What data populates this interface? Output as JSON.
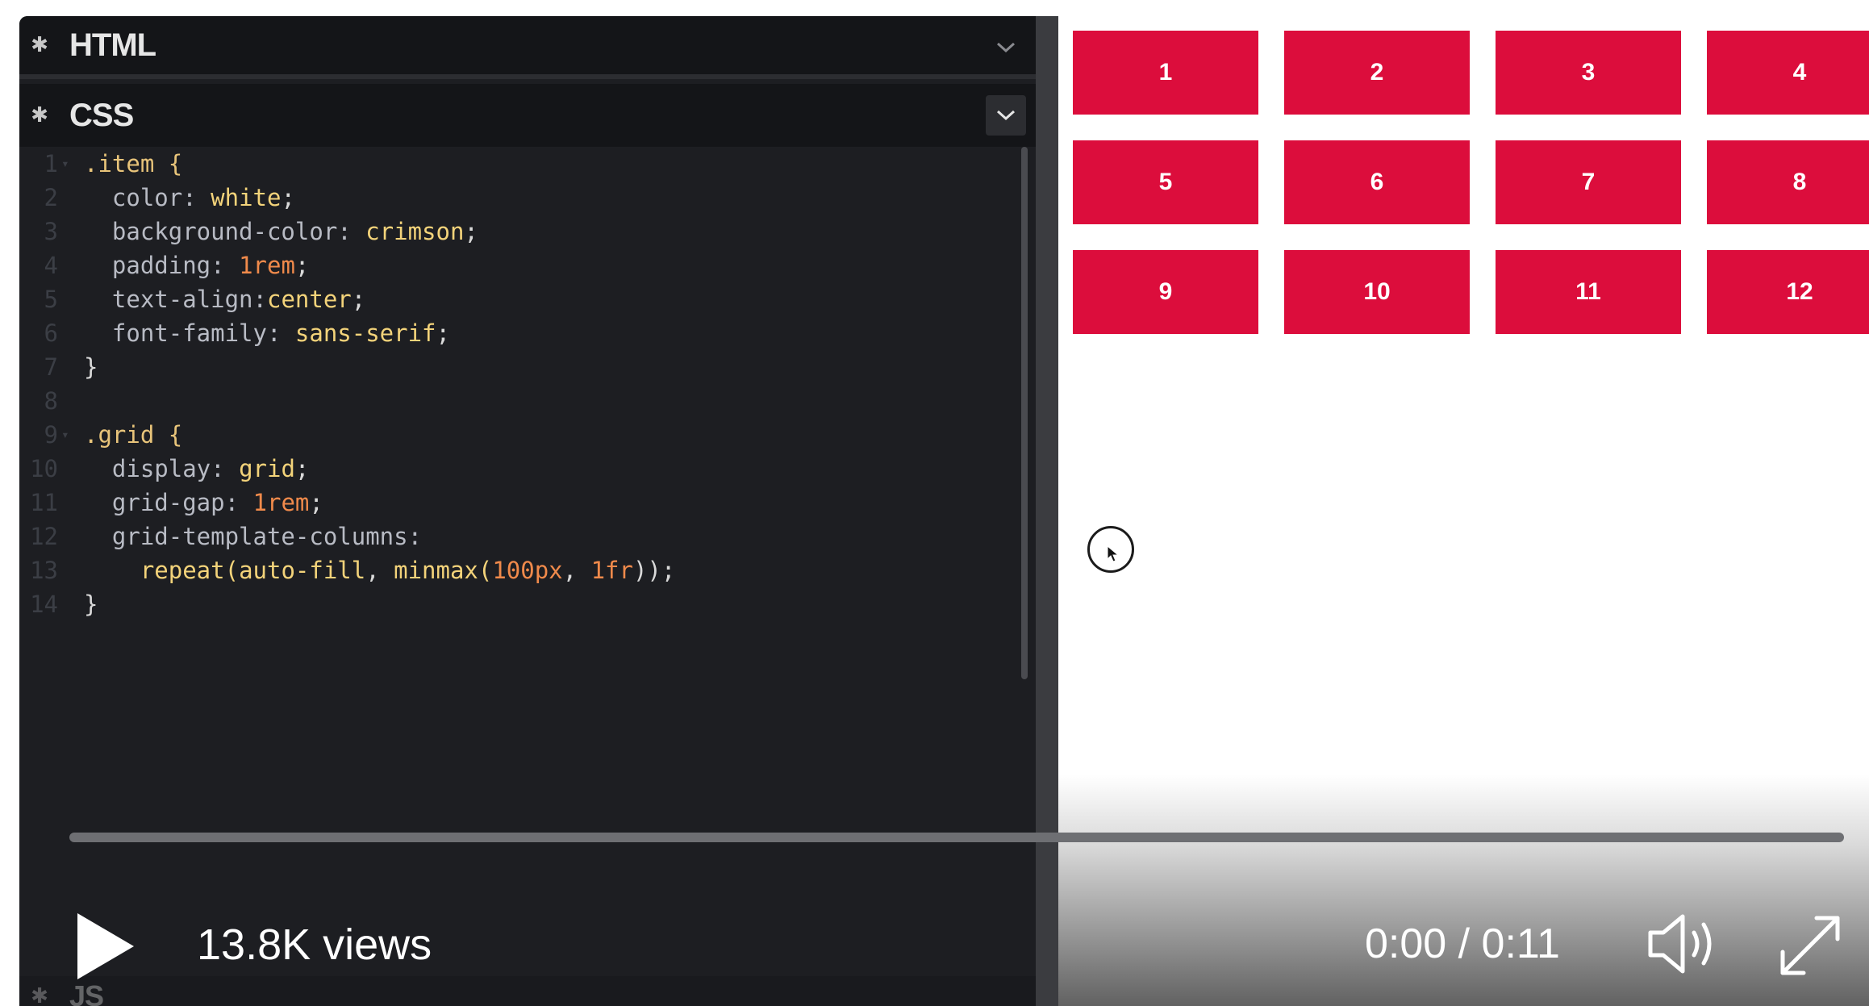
{
  "editor": {
    "html_panel": {
      "title": "HTML",
      "icon": "gear-icon"
    },
    "css_panel": {
      "title": "CSS",
      "icon": "gear-icon"
    },
    "js_panel": {
      "title": "JS",
      "icon": "gear-icon"
    },
    "css_lines": [
      {
        "n": "1",
        "fold": true
      },
      {
        "n": "2"
      },
      {
        "n": "3"
      },
      {
        "n": "4"
      },
      {
        "n": "5"
      },
      {
        "n": "6"
      },
      {
        "n": "7"
      },
      {
        "n": "8"
      },
      {
        "n": "9",
        "fold": true
      },
      {
        "n": "10"
      },
      {
        "n": "11"
      },
      {
        "n": "12"
      },
      {
        "n": "13"
      },
      {
        "n": "14"
      }
    ],
    "css_code": {
      "l1": ".item {",
      "l2_prop": "color:",
      "l2_val": "white",
      "l3_prop": "background-color:",
      "l3_val": "crimson",
      "l4_prop": "padding:",
      "l4_val": "1rem",
      "l5_prop": "text-align:",
      "l5_val": "center",
      "l6_prop": "font-family:",
      "l6_val": "sans-serif",
      "l7": "}",
      "l9": ".grid {",
      "l10_prop": "display:",
      "l10_val": "grid",
      "l11_prop": "grid-gap:",
      "l11_val": "1rem",
      "l12_prop": "grid-template-columns:",
      "l13_a": "repeat(",
      "l13_b": "auto-fill",
      "l13_c": ", ",
      "l13_d": "minmax(",
      "l13_e": "100px",
      "l13_f": ", ",
      "l13_g": "1fr",
      "l13_h": "));",
      "l14": "}"
    }
  },
  "preview": {
    "items": [
      "1",
      "2",
      "3",
      "4",
      "5",
      "6",
      "7",
      "8",
      "9",
      "10",
      "11",
      "12"
    ],
    "item_color": "#dc0d3c"
  },
  "video": {
    "views": "13.8K views",
    "time": "0:00 / 0:11",
    "progress": 0.0,
    "play_icon": "play-icon",
    "volume_icon": "volume-icon",
    "fullscreen_icon": "fullscreen-icon"
  }
}
